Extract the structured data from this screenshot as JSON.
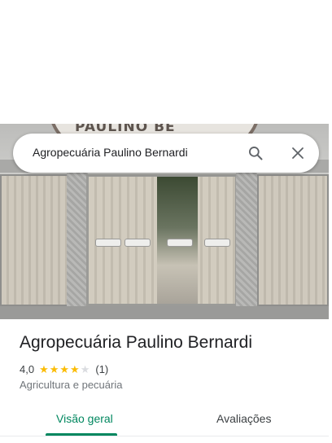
{
  "search": {
    "query": "Agropecuária Paulino Bernardi"
  },
  "photo": {
    "sign_text": "PAULINO BE"
  },
  "place": {
    "name": "Agropecuária Paulino Bernardi",
    "rating_value": "4,0",
    "rating_stars": 4,
    "rating_max": 5,
    "review_count": "(1)",
    "category": "Agricultura e pecuária"
  },
  "tabs": [
    {
      "label": "Visão geral",
      "selected": true
    },
    {
      "label": "Avaliações",
      "selected": false
    }
  ],
  "colors": {
    "accent": "#01875f",
    "star": "#fbbc04",
    "star_empty": "#dadce0"
  },
  "icons": [
    "search-icon",
    "close-icon",
    "star-icon"
  ]
}
